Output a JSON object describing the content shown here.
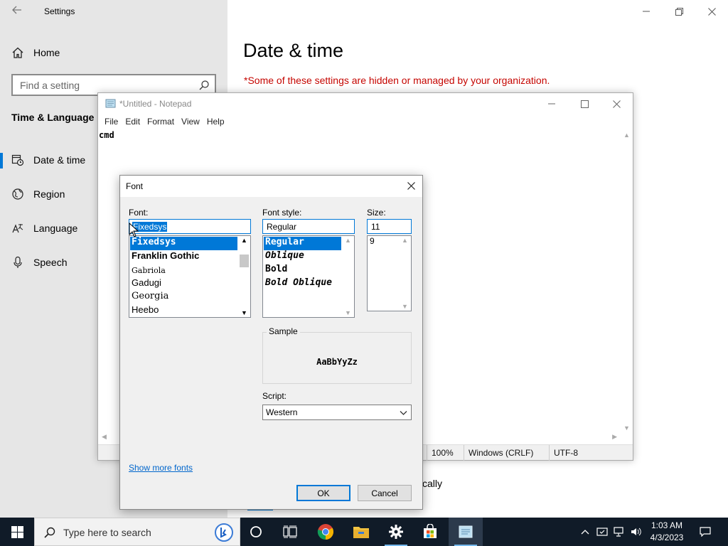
{
  "settings": {
    "window_title": "Settings",
    "home_label": "Home",
    "search_placeholder": "Find a setting",
    "section_title": "Time & Language",
    "nav": [
      {
        "label": "Date & time",
        "icon": "calendar-clock-icon",
        "active": true
      },
      {
        "label": "Region",
        "icon": "globe-icon",
        "active": false
      },
      {
        "label": "Language",
        "icon": "language-icon",
        "active": false
      },
      {
        "label": "Speech",
        "icon": "microphone-icon",
        "active": false
      }
    ],
    "page_heading": "Date & time",
    "managed_note": "*Some of these settings are hidden or managed by your organization.",
    "partial_text": "cally"
  },
  "notepad": {
    "title": "*Untitled - Notepad",
    "menu": [
      "File",
      "Edit",
      "Format",
      "View",
      "Help"
    ],
    "content": "cmd",
    "status": {
      "zoom": "100%",
      "line_ending": "Windows (CRLF)",
      "encoding": "UTF-8"
    }
  },
  "font_dialog": {
    "title": "Font",
    "font_label": "Font:",
    "font_value": "Fixedsys",
    "fonts": [
      "Fixedsys",
      "Franklin Gothic",
      "Gabriola",
      "Gadugi",
      "Georgia",
      "Heebo"
    ],
    "style_label": "Font style:",
    "style_value": "Regular",
    "styles": [
      "Regular",
      "Oblique",
      "Bold",
      "Bold Oblique"
    ],
    "size_label": "Size:",
    "size_value": "11",
    "sizes": [
      "9"
    ],
    "sample_label": "Sample",
    "sample_text": "AaBbYyZz",
    "script_label": "Script:",
    "script_value": "Western",
    "show_more_link": "Show more fonts",
    "ok_label": "OK",
    "cancel_label": "Cancel"
  },
  "taskbar": {
    "search_placeholder": "Type here to search",
    "time": "1:03 AM",
    "date": "4/3/2023",
    "pinned": [
      "task-view-icon",
      "cortana-icon",
      "chrome-icon",
      "file-explorer-icon",
      "settings-icon",
      "store-icon",
      "notepad-icon"
    ]
  },
  "colors": {
    "accent": "#0078d7",
    "warning_text": "#c50500",
    "taskbar_bg": "#101b28",
    "sidebar_bg": "#e6e6e6",
    "dialog_bg": "#f0f0f0"
  }
}
